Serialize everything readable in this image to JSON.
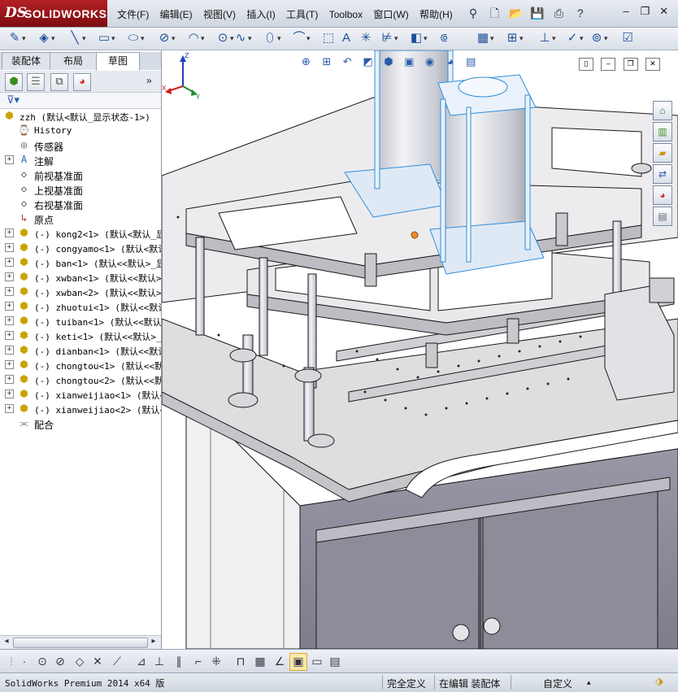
{
  "app": {
    "logo_ds": "DS",
    "logo_name": "SOLIDWORKS"
  },
  "menu": [
    "文件(F)",
    "编辑(E)",
    "视图(V)",
    "插入(I)",
    "工具(T)",
    "Toolbox",
    "窗口(W)",
    "帮助(H)"
  ],
  "quick_access": [
    "pin-icon",
    "new-doc-icon",
    "open-icon",
    "save-icon",
    "print-icon",
    "help-icon"
  ],
  "window_controls": {
    "minimize": "–",
    "restore": "❐",
    "close": "✕"
  },
  "tabs": [
    "装配体",
    "布局",
    "草图"
  ],
  "active_tab": "草图",
  "feature_manager_icons": [
    "feature-tree-icon",
    "property-manager-icon",
    "configuration-icon",
    "appearance-icon"
  ],
  "tree": {
    "root": "zzh  (默认<默认_显示状态-1>)",
    "items": [
      {
        "type": "history",
        "label": "History",
        "expandable": false
      },
      {
        "type": "sensor",
        "label": "传感器",
        "expandable": false
      },
      {
        "type": "annotation",
        "label": "注解",
        "expandable": true
      },
      {
        "type": "plane",
        "label": "前视基准面",
        "expandable": false
      },
      {
        "type": "plane",
        "label": "上视基准面",
        "expandable": false
      },
      {
        "type": "plane",
        "label": "右视基准面",
        "expandable": false
      },
      {
        "type": "origin",
        "label": "原点",
        "expandable": false
      },
      {
        "type": "part",
        "label": "(-) kong2<1> (默认<默认_显",
        "expandable": true
      },
      {
        "type": "part",
        "label": "(-) congyamo<1> (默认<默认",
        "expandable": true
      },
      {
        "type": "part",
        "label": "(-) ban<1> (默认<<默认>_显",
        "expandable": true
      },
      {
        "type": "part",
        "label": "(-) xwban<1> (默认<<默认>",
        "expandable": true
      },
      {
        "type": "part",
        "label": "(-) xwban<2> (默认<<默认>",
        "expandable": true
      },
      {
        "type": "part",
        "label": "(-) zhuotui<1> (默认<<默认",
        "expandable": true
      },
      {
        "type": "part",
        "label": "(-) tuiban<1> (默认<<默认>",
        "expandable": true
      },
      {
        "type": "part",
        "label": "(-) keti<1> (默认<<默认>_",
        "expandable": true
      },
      {
        "type": "part",
        "label": "(-) dianban<1> (默认<<默认",
        "expandable": true
      },
      {
        "type": "part",
        "label": "(-) chongtou<1> (默认<<默",
        "expandable": true
      },
      {
        "type": "part",
        "label": "(-) chongtou<2> (默认<<默",
        "expandable": true
      },
      {
        "type": "part",
        "label": "(-) xianweijiao<1> (默认<",
        "expandable": true
      },
      {
        "type": "part",
        "label": "(-) xianweijiao<2> (默认<",
        "expandable": true
      },
      {
        "type": "mate",
        "label": "配合",
        "expandable": false
      }
    ]
  },
  "status": {
    "version": "SolidWorks Premium 2014 x64 版",
    "definition": "完全定义",
    "mode": "在编辑 装配体",
    "units": "自定义",
    "units_arrow": "▴"
  },
  "colors": {
    "accent": "#1d4f9a",
    "brand_red": "#b32024",
    "selection_blue": "#2f8fd8",
    "model_fill": "#e6e6ea",
    "model_edge": "#1a1a1a"
  }
}
